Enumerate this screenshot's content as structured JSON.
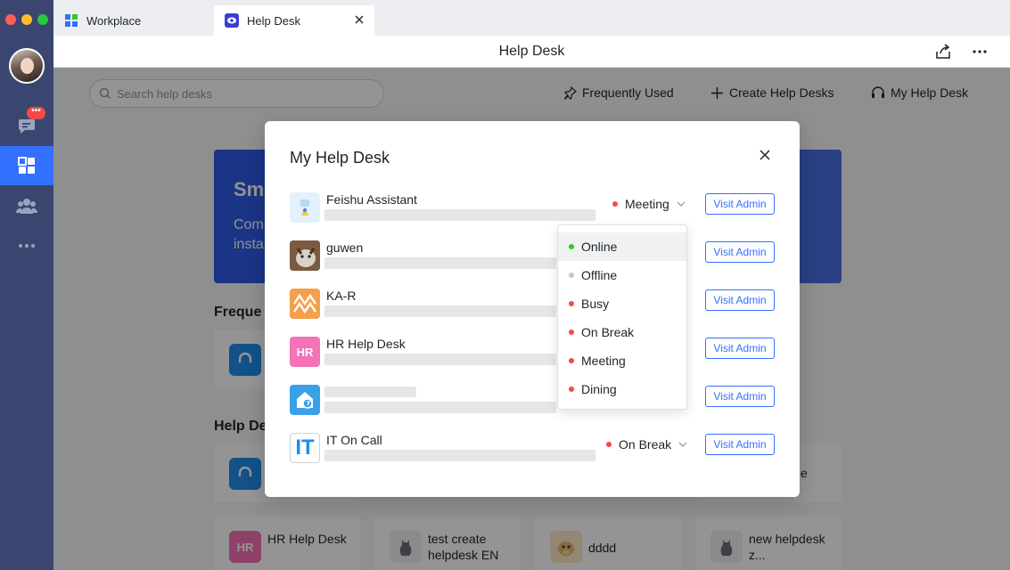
{
  "colors": {
    "accent": "#3370ff",
    "online": "#34c724",
    "offline": "#c4c6c9",
    "red_status": "#f54a45"
  },
  "rail": {
    "chat_badge": "•••",
    "icons": [
      "chat-icon",
      "workplace-icon",
      "contacts-icon",
      "more-icon"
    ]
  },
  "tabs": [
    {
      "label": "Workplace",
      "icon": "workplace-grid-icon"
    },
    {
      "label": "Help Desk",
      "icon": "help-desk-eye-icon",
      "active": true
    }
  ],
  "header": {
    "title": "Help Desk"
  },
  "toolbar": {
    "search_placeholder": "Search help desks",
    "frequently_used": "Frequently Used",
    "create_help_desks": "Create Help Desks",
    "my_help_desk": "My Help Desk"
  },
  "banner": {
    "title": "Sm",
    "line1": "Com",
    "line2": "insta"
  },
  "sections": {
    "frequent": "Freque",
    "help_desks": "Help De"
  },
  "bottom_cards": [
    {
      "icon_text": "HR",
      "label": "HR Help Desk"
    },
    {
      "label": "test create helpdesk EN"
    },
    {
      "label": "dddd"
    },
    {
      "label": "new helpdesk z..."
    }
  ],
  "partial_card_text": "e",
  "modal": {
    "title": "My Help Desk",
    "visit_label": "Visit Admin",
    "rows": [
      {
        "name": "Feishu Assistant",
        "status": "Meeting",
        "icon": "feishu-assistant-icon"
      },
      {
        "name": "guwen",
        "icon": "cat-avatar-icon"
      },
      {
        "name": "KA-R",
        "icon": "ka-r-logo-icon"
      },
      {
        "name": "HR Help Desk",
        "icon_text": "HR"
      },
      {
        "name": "",
        "icon": "house-help-icon"
      },
      {
        "name": "IT On Call",
        "icon_text": "IT",
        "status": "On Break"
      }
    ]
  },
  "status_dropdown": {
    "selected": "Online",
    "options": [
      {
        "label": "Online",
        "color": "#34c724"
      },
      {
        "label": "Offline",
        "color": "#c4c6c9"
      },
      {
        "label": "Busy",
        "color": "#f54a45"
      },
      {
        "label": "On Break",
        "color": "#f54a45"
      },
      {
        "label": "Meeting",
        "color": "#f54a45"
      },
      {
        "label": "Dining",
        "color": "#f54a45"
      }
    ]
  }
}
